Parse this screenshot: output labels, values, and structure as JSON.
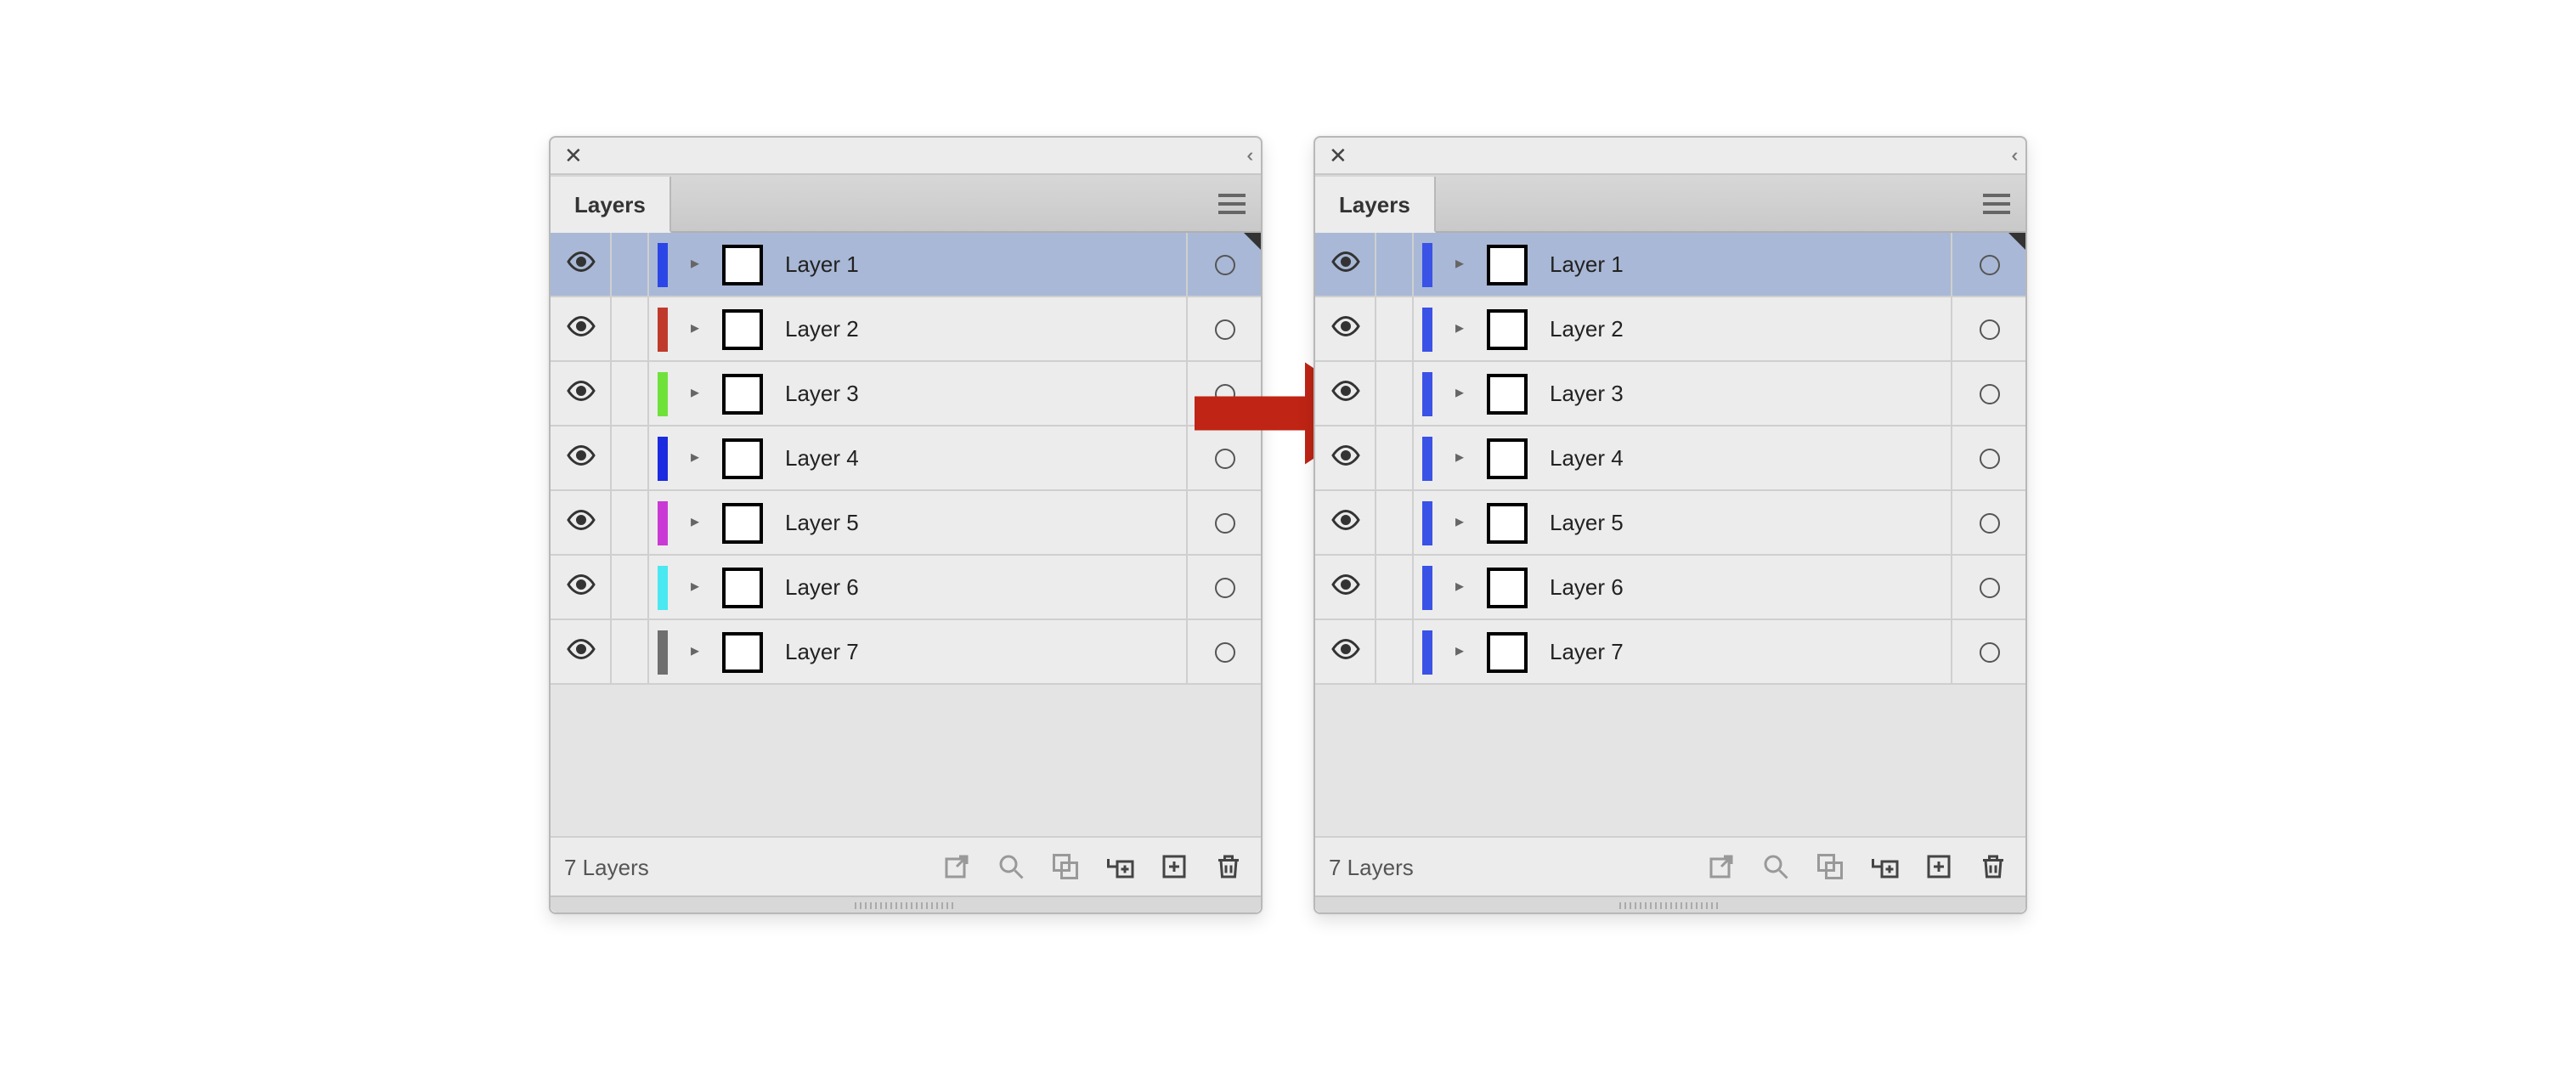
{
  "panel_tab_label": "Layers",
  "layer_count_text": "7 Layers",
  "panels": {
    "left": {
      "layers": [
        {
          "name": "Layer 1",
          "color": "#2b46e6",
          "selected": true
        },
        {
          "name": "Layer 2",
          "color": "#c03a2b",
          "selected": false
        },
        {
          "name": "Layer 3",
          "color": "#6fe23a",
          "selected": false
        },
        {
          "name": "Layer 4",
          "color": "#1b2be0",
          "selected": false
        },
        {
          "name": "Layer 5",
          "color": "#c93ad4",
          "selected": false
        },
        {
          "name": "Layer 6",
          "color": "#4ae8f0",
          "selected": false
        },
        {
          "name": "Layer 7",
          "color": "#6f6f6f",
          "selected": false
        }
      ]
    },
    "right": {
      "layers": [
        {
          "name": "Layer 1",
          "color": "#3a52e6",
          "selected": true
        },
        {
          "name": "Layer 2",
          "color": "#3a52e6",
          "selected": false
        },
        {
          "name": "Layer 3",
          "color": "#3a52e6",
          "selected": false
        },
        {
          "name": "Layer 4",
          "color": "#3a52e6",
          "selected": false
        },
        {
          "name": "Layer 5",
          "color": "#3a52e6",
          "selected": false
        },
        {
          "name": "Layer 6",
          "color": "#3a52e6",
          "selected": false
        },
        {
          "name": "Layer 7",
          "color": "#3a52e6",
          "selected": false
        }
      ]
    }
  },
  "arrow_color": "#bf2414",
  "icons": {
    "close": "close-icon",
    "collapse": "collapse-chevrons-icon",
    "menu": "panel-menu-icon",
    "eye": "visibility-eye-icon",
    "expand": "expand-triangle-icon",
    "target": "target-ring-icon",
    "export": "export-icon",
    "search": "search-icon",
    "clip": "clipping-mask-icon",
    "newsub": "new-sublayer-icon",
    "new": "new-layer-icon",
    "trash": "trash-icon"
  }
}
